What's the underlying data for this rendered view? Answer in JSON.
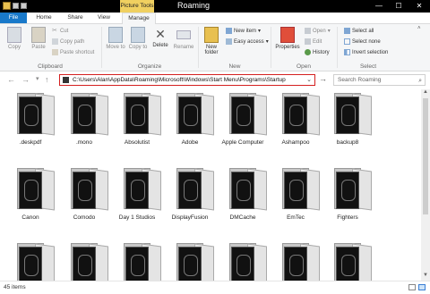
{
  "window": {
    "title": "Roaming",
    "contextual_tab": "Picture Tools",
    "controls": {
      "minimize": "—",
      "maximize": "☐",
      "close": "✕"
    }
  },
  "tabs": [
    {
      "label": "File"
    },
    {
      "label": "Home"
    },
    {
      "label": "Share"
    },
    {
      "label": "View"
    },
    {
      "label": "Manage"
    }
  ],
  "ribbon": {
    "clipboard": {
      "label": "Clipboard",
      "copy": "Copy",
      "paste": "Paste",
      "cut": "Cut",
      "copy_path": "Copy path",
      "paste_shortcut": "Paste shortcut"
    },
    "organize": {
      "label": "Organize",
      "move_to": "Move to",
      "copy_to": "Copy to",
      "delete": "Delete",
      "rename": "Rename"
    },
    "new": {
      "label": "New",
      "new_folder": "New folder",
      "new_item": "New item",
      "easy_access": "Easy access"
    },
    "open": {
      "label": "Open",
      "properties": "Properties",
      "open": "Open",
      "edit": "Edit",
      "history": "History"
    },
    "select": {
      "label": "Select",
      "select_all": "Select all",
      "select_none": "Select none",
      "invert_selection": "Invert selection"
    }
  },
  "address": {
    "path": "C:\\Users\\Alan\\AppData\\Roaming\\Microsoft\\Windows\\Start Menu\\Programs\\Startup",
    "search_placeholder": "Search Roaming"
  },
  "items": [
    {
      "label": ".deskpdf"
    },
    {
      "label": ".mono"
    },
    {
      "label": "Absolutist"
    },
    {
      "label": "Adobe"
    },
    {
      "label": "Apple Computer"
    },
    {
      "label": "Ashampoo"
    },
    {
      "label": "backup8"
    },
    {
      "label": "Canon"
    },
    {
      "label": "Comodo"
    },
    {
      "label": "Day 1 Studios"
    },
    {
      "label": "DisplayFusion"
    },
    {
      "label": "DMCache"
    },
    {
      "label": "EmTec"
    },
    {
      "label": "Fighters"
    },
    {
      "label": ""
    },
    {
      "label": ""
    },
    {
      "label": ""
    },
    {
      "label": ""
    },
    {
      "label": ""
    },
    {
      "label": ""
    },
    {
      "label": ""
    }
  ],
  "status": {
    "item_count": "45 items"
  },
  "colors": {
    "file_tab": "#1979ca",
    "contextual": "#f0d060",
    "address_border": "#d42020",
    "titlebar": "#000000"
  }
}
